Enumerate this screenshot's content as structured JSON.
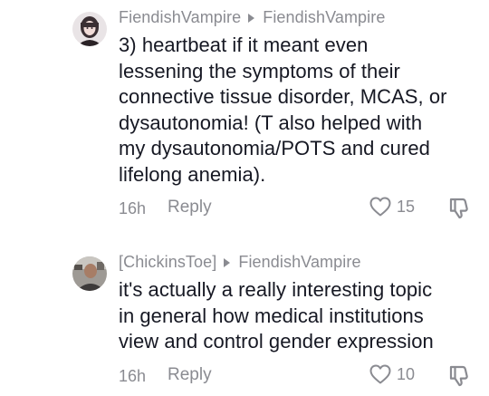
{
  "comments": [
    {
      "author": "FiendishVampire",
      "reply_to": "FiendishVampire",
      "lines": [
        "3) heartbeat if it meant even",
        "lessening the symptoms of their",
        "connective tissue disorder, MCAS, or",
        "dysautonomia! (T also helped with",
        "my dysautonomia/POTS and cured",
        "lifelong anemia)."
      ],
      "time": "16h",
      "reply_label": "Reply",
      "likes": "15"
    },
    {
      "author": "[ChickinsToe]",
      "reply_to": "FiendishVampire",
      "lines": [
        "it's actually a really interesting topic",
        "in general how medical institutions",
        "view and control gender expression"
      ],
      "time": "16h",
      "reply_label": "Reply",
      "likes": "10"
    }
  ],
  "icons": {
    "like": "heart-outline-icon",
    "dislike": "thumbs-down-icon",
    "reply_arrow": "triangle-right-icon"
  },
  "colors": {
    "text": "#161823",
    "muted": "#8a8b91",
    "background": "#ffffff"
  }
}
